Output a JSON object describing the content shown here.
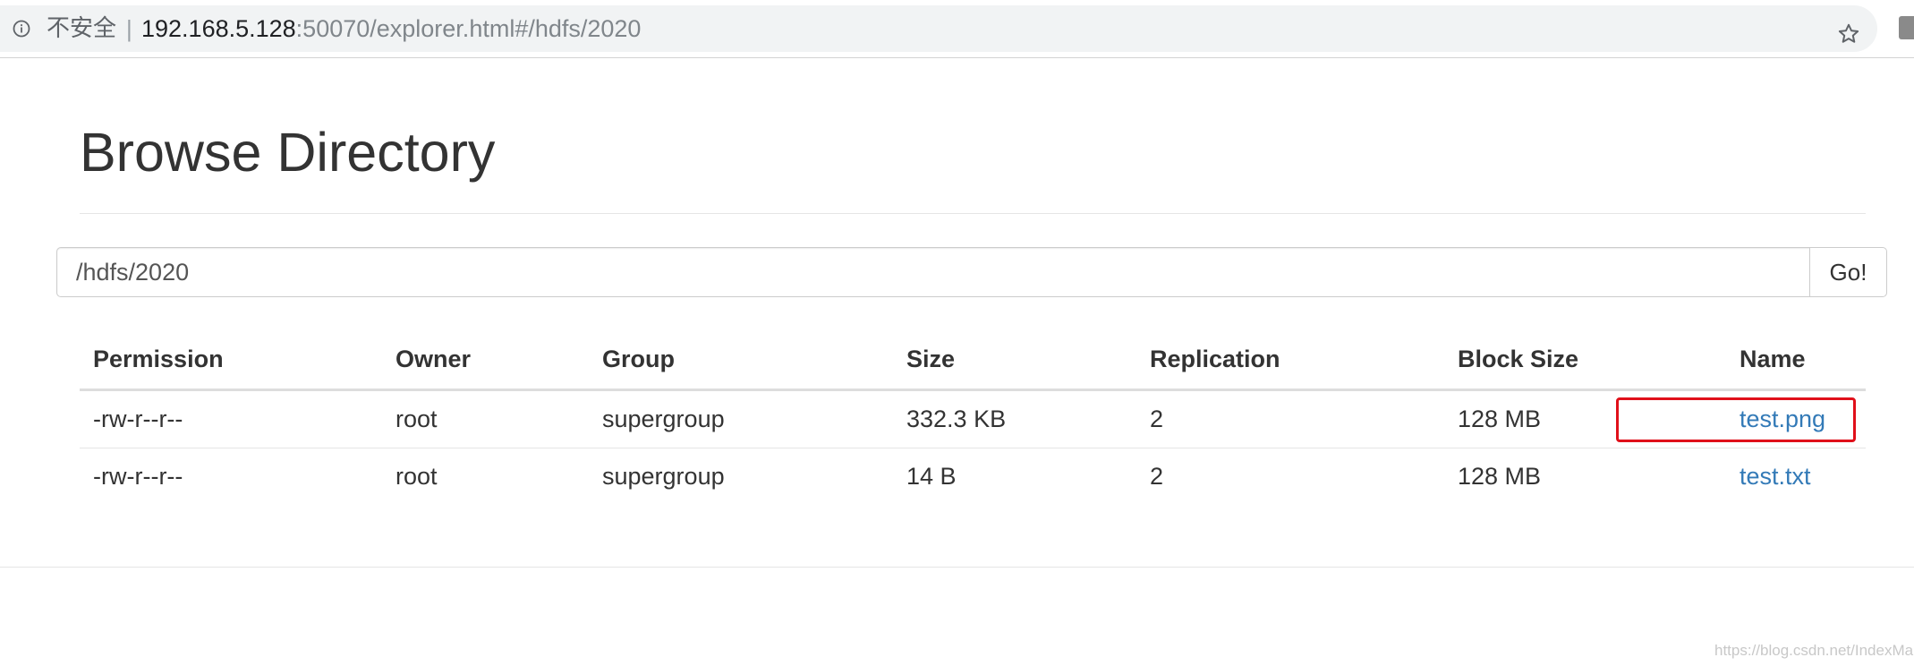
{
  "browser": {
    "security_label": "不安全",
    "divider": "|",
    "url_host": "192.168.5.128",
    "url_rest": ":50070/explorer.html#/hdfs/2020"
  },
  "page": {
    "title": "Browse Directory"
  },
  "path_bar": {
    "value": "/hdfs/2020",
    "go_label": "Go!"
  },
  "table": {
    "headers": [
      "Permission",
      "Owner",
      "Group",
      "Size",
      "Replication",
      "Block Size",
      "Name"
    ],
    "rows": [
      {
        "permission": "-rw-r--r--",
        "owner": "root",
        "group": "supergroup",
        "size": "332.3 KB",
        "replication": "2",
        "block_size": "128 MB",
        "name": "test.png",
        "highlighted": true
      },
      {
        "permission": "-rw-r--r--",
        "owner": "root",
        "group": "supergroup",
        "size": "14 B",
        "replication": "2",
        "block_size": "128 MB",
        "name": "test.txt",
        "highlighted": false
      }
    ]
  },
  "watermark": "https://blog.csdn.net/IndexMan",
  "colors": {
    "link": "#337ab7",
    "highlight": "#e0101a"
  },
  "icons": {
    "info": "info-icon",
    "star": "star-icon",
    "extension": "extension-icon"
  }
}
